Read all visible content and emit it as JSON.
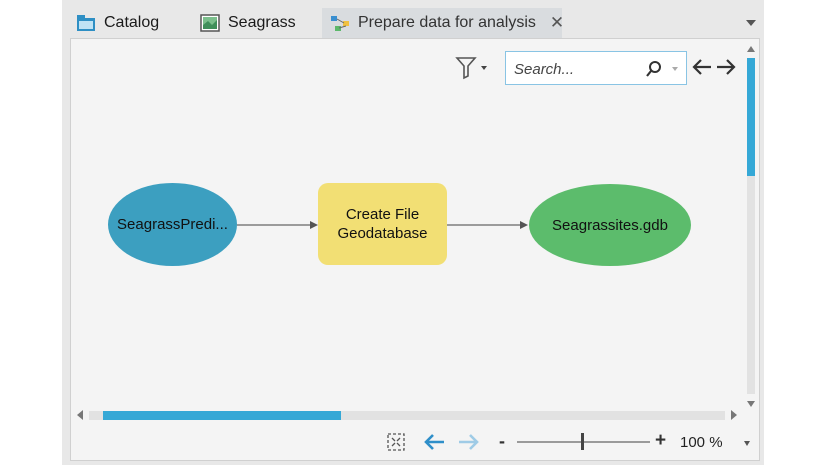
{
  "tabs": [
    {
      "label": "Catalog",
      "icon": "catalog-folder-icon"
    },
    {
      "label": "Seagrass",
      "icon": "map-icon"
    },
    {
      "label": "Prepare data for analysis",
      "icon": "model-icon",
      "active": true,
      "close": "✕"
    }
  ],
  "toolbar": {
    "search_placeholder": "Search..."
  },
  "diagram": {
    "nodes": [
      {
        "label": "SeagrassPredi...",
        "shape": "ellipse",
        "color": "#3c9fc0"
      },
      {
        "label": "Create File\nGeodatabase",
        "shape": "rounded-rect",
        "color": "#f2df74"
      },
      {
        "label": "Seagrassites.gdb",
        "shape": "ellipse",
        "color": "#5cbc6c"
      }
    ]
  },
  "statusbar": {
    "zoom_minus": "-",
    "zoom_plus": "+",
    "zoom_level": "100 %",
    "zoom_slider_fraction": 0.5
  },
  "colors": {
    "accent": "#35a8d6",
    "arrow_active": "#2f8fc9",
    "arrow_inactive": "#9fcbe6"
  }
}
